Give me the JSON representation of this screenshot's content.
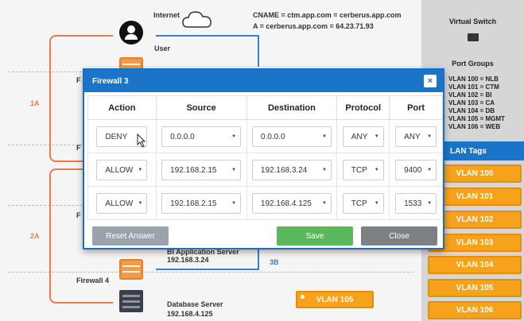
{
  "diagram": {
    "internet_label": "Internet",
    "dns_line1": "CNAME = ctm.app.com = cerberus.app.com",
    "dns_line2": "A = cerberus.app.com = 64.23.71.93",
    "user_label": "User",
    "label_1a": "1A",
    "label_2a": "2A",
    "label_3b": "3B",
    "fw_prefix_1": "F",
    "fw_prefix_2": "F",
    "fw_prefix_3": "F",
    "bi_server_label": "BI Application Server",
    "bi_server_ip": "192.168.3.24",
    "firewall4_label": "Firewall 4",
    "db_server_label": "Database Server",
    "db_server_ip": "192.168.4.125",
    "vlan105_mini": "VLAN 105"
  },
  "right_panel": {
    "virtual_switch": "Virtual Switch",
    "port_groups": "Port Groups",
    "groups": [
      "VLAN 100 = NLB",
      "VLAN 101 = CTM",
      "VLAN 102 = BI",
      "VLAN 103 = CA",
      "VLAN 104 = DB",
      "VLAN 105 = MGMT",
      "VLAN 106 = WEB"
    ],
    "vlan_tags_header": "LAN Tags",
    "vlan_tags": [
      "VLAN 100",
      "VLAN 101",
      "VLAN 102",
      "VLAN 103",
      "VLAN 104",
      "VLAN 105",
      "VLAN 106"
    ]
  },
  "modal": {
    "title": "Firewall 3",
    "close_symbol": "×",
    "headers": [
      "Action",
      "Source",
      "Destination",
      "Protocol",
      "Port"
    ],
    "rows": [
      {
        "action": "DENY",
        "source": "0.0.0.0",
        "destination": "0.0.0.0",
        "protocol": "ANY",
        "port": "ANY"
      },
      {
        "action": "ALLOW",
        "source": "192.168.2.15",
        "destination": "192.168.3.24",
        "protocol": "TCP",
        "port": "9400"
      },
      {
        "action": "ALLOW",
        "source": "192.168.2.15",
        "destination": "192.168.4.125",
        "protocol": "TCP",
        "port": "1533"
      }
    ],
    "reset_label": "Reset Answer",
    "save_label": "Save",
    "close_label": "Close"
  },
  "colors": {
    "modal_blue": "#1a75c8",
    "vlan_orange": "#f7a21b",
    "save_green": "#5cb85c",
    "flow_orange": "#ef7a4a",
    "flow_blue": "#3b7dd8"
  }
}
